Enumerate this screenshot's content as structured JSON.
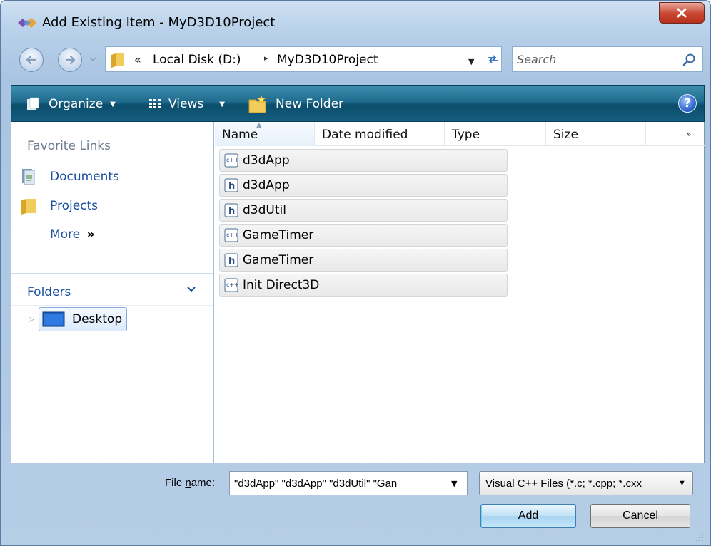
{
  "window": {
    "title": "Add Existing Item - MyD3D10Project",
    "close_glyph": "X"
  },
  "address": {
    "overflow": "«",
    "crumbs": [
      "Local Disk (D:)",
      "MyD3D10Project"
    ],
    "separator": "▸",
    "search_placeholder": "Search"
  },
  "toolbar": {
    "organize": "Organize",
    "views": "Views",
    "new_folder": "New Folder",
    "help": "?"
  },
  "nav": {
    "favorites_title": "Favorite Links",
    "favorites": [
      "Documents",
      "Projects"
    ],
    "more": "More",
    "more_glyph": "»",
    "folders_title": "Folders",
    "tree_expander": "▷",
    "tree_item": "Desktop"
  },
  "files": {
    "columns": [
      "Name",
      "Date modified",
      "Type",
      "Size"
    ],
    "columns_more": "»",
    "items": [
      {
        "name": "d3dApp",
        "icon": "cpp-file-icon"
      },
      {
        "name": "d3dApp",
        "icon": "header-file-icon"
      },
      {
        "name": "d3dUtil",
        "icon": "header-file-icon"
      },
      {
        "name": "GameTimer",
        "icon": "cpp-file-icon"
      },
      {
        "name": "GameTimer",
        "icon": "header-file-icon"
      },
      {
        "name": "Init Direct3D",
        "icon": "cpp-file-icon"
      }
    ]
  },
  "bottom": {
    "file_name_label_prefix": "File ",
    "file_name_label_mnemonic": "n",
    "file_name_label_suffix": "ame:",
    "file_name_value": "\"d3dApp\" \"d3dApp\" \"d3dUtil\" \"Gan",
    "filter_value": "Visual C++ Files (*.c; *.cpp; *.cxx",
    "add_label": "Add",
    "cancel_label": "Cancel"
  },
  "dropdown_glyph": "▼"
}
